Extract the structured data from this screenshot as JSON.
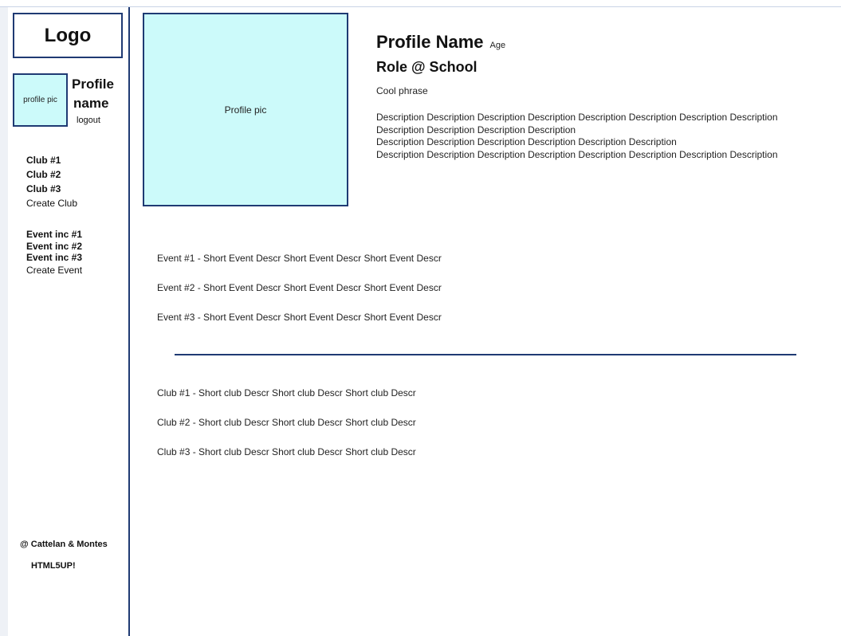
{
  "sidebar": {
    "logo": "Logo",
    "profile_pic_label": "profile pic",
    "profile_name_line1": "Profile",
    "profile_name_line2": "name",
    "logout": "logout",
    "clubs": [
      "Club #1",
      "Club #2",
      "Club #3"
    ],
    "create_club": "Create Club",
    "events": [
      "Event inc #1",
      "Event inc #2",
      "Event inc #3"
    ],
    "create_event": "Create Event",
    "credit_line1": "@ Cattelan & Montes",
    "credit_line2": "HTML5UP!"
  },
  "profile": {
    "pic_label": "Profile pic",
    "name": "Profile Name",
    "age": "Age",
    "role": "Role @ School",
    "phrase": "Cool phrase",
    "description_lines": [
      "Description Description Description Description Description Description Description Description",
      "Description Description Description Description",
      "Description Description Description Description Description Description",
      "Description Description Description Description Description Description Description Description"
    ]
  },
  "events_list": [
    "Event #1 - Short Event Descr Short Event Descr Short Event Descr",
    "Event #2 - Short Event Descr Short Event Descr Short Event Descr",
    "Event #3 -  Short Event Descr Short Event Descr Short Event Descr"
  ],
  "clubs_list": [
    "Club #1 - Short club Descr Short club Descr Short club Descr",
    "Club #2 - Short club Descr Short club Descr Short club Descr",
    "Club #3 - Short club Descr Short club Descr Short club Descr"
  ],
  "colors": {
    "accent": "#1f3a73",
    "pic_fill": "#ccfafa"
  }
}
